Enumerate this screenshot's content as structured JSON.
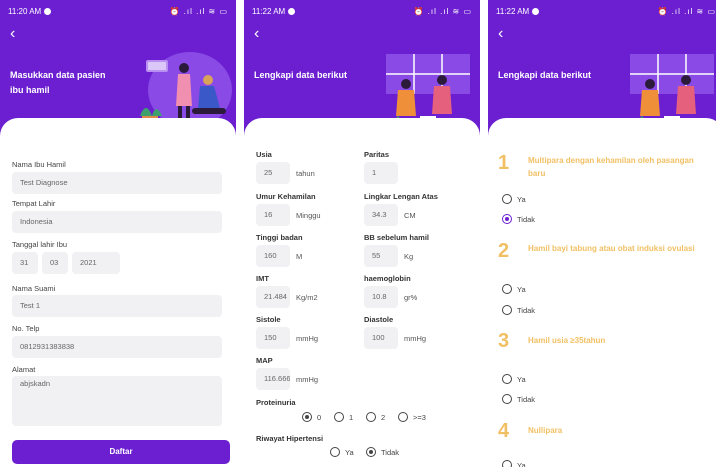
{
  "screen1": {
    "time": "11:20 AM",
    "status_icons": "⏰ .ıl .ıl ≋ ▭",
    "title": "Masukkan data pasien ibu hamil",
    "fields": {
      "nama_label": "Nama Ibu Hamil",
      "nama_value": "Test Diagnose",
      "tempat_label": "Tempat Lahir",
      "tempat_value": "Indonesia",
      "tanggal_label": "Tanggal lahir Ibu",
      "tanggal_day": "31",
      "tanggal_month": "03",
      "tanggal_year": "2021",
      "suami_label": "Nama Suami",
      "suami_value": "Test 1",
      "telp_label": "No. Telp",
      "telp_value": "0812931383838",
      "alamat_label": "Alamat",
      "alamat_value": "abjskadn"
    },
    "submit_label": "Daftar"
  },
  "screen2": {
    "time": "11:22 AM",
    "status_icons": "⏰ .ıl .ıl ≋ ▭",
    "title": "Lengkapi data berikut",
    "fields": {
      "usia_label": "Usia",
      "usia_value": "25",
      "usia_unit": "tahun",
      "paritas_label": "Paritas",
      "paritas_value": "1",
      "umur_label": "Umur Kehamilan",
      "umur_value": "16",
      "umur_unit": "Minggu",
      "lila_label": "Lingkar Lengan Atas",
      "lila_value": "34.3",
      "lila_unit": "CM",
      "tinggi_label": "Tinggi badan",
      "tinggi_value": "160",
      "tinggi_unit": "M",
      "bb_label": "BB sebelum hamil",
      "bb_value": "55",
      "bb_unit": "Kg",
      "imt_label": "IMT",
      "imt_value": "21.484",
      "imt_unit": "Kg/m2",
      "hb_label": "haemoglobin",
      "hb_value": "10.8",
      "hb_unit": "gr%",
      "sistole_label": "Sistole",
      "sistole_value": "150",
      "sistole_unit": "mmHg",
      "diastole_label": "Diastole",
      "diastole_value": "100",
      "diastole_unit": "mmHg",
      "map_label": "MAP",
      "map_value": "116.666",
      "map_unit": "mmHg",
      "proteinuria_label": "Proteinuria",
      "proteinuria_options": [
        "0",
        "1",
        "2",
        ">=3"
      ],
      "riwayat_label": "Riwayat Hipertensi",
      "riwayat_options": [
        "Ya",
        "Tidak"
      ]
    }
  },
  "screen3": {
    "time": "11:22 AM",
    "status_icons": "⏰ .ıl .ıl ≋ ▭",
    "title": "Lengkapi data berikut",
    "questions": [
      {
        "num": "1",
        "text": "Multipara dengan kehamilan oleh pasangan baru",
        "yes": "Ya",
        "no": "Tidak"
      },
      {
        "num": "2",
        "text": "Hamil bayi tabung atau obat induksi ovulasi",
        "yes": "Ya",
        "no": "Tidak"
      },
      {
        "num": "3",
        "text": "Hamil usia ≥35tahun",
        "yes": "Ya",
        "no": "Tidak"
      },
      {
        "num": "4",
        "text": "Nullipara",
        "yes": "Ya"
      }
    ]
  },
  "colors": {
    "primary": "#6b1fd0",
    "accent": "#f1c064"
  }
}
